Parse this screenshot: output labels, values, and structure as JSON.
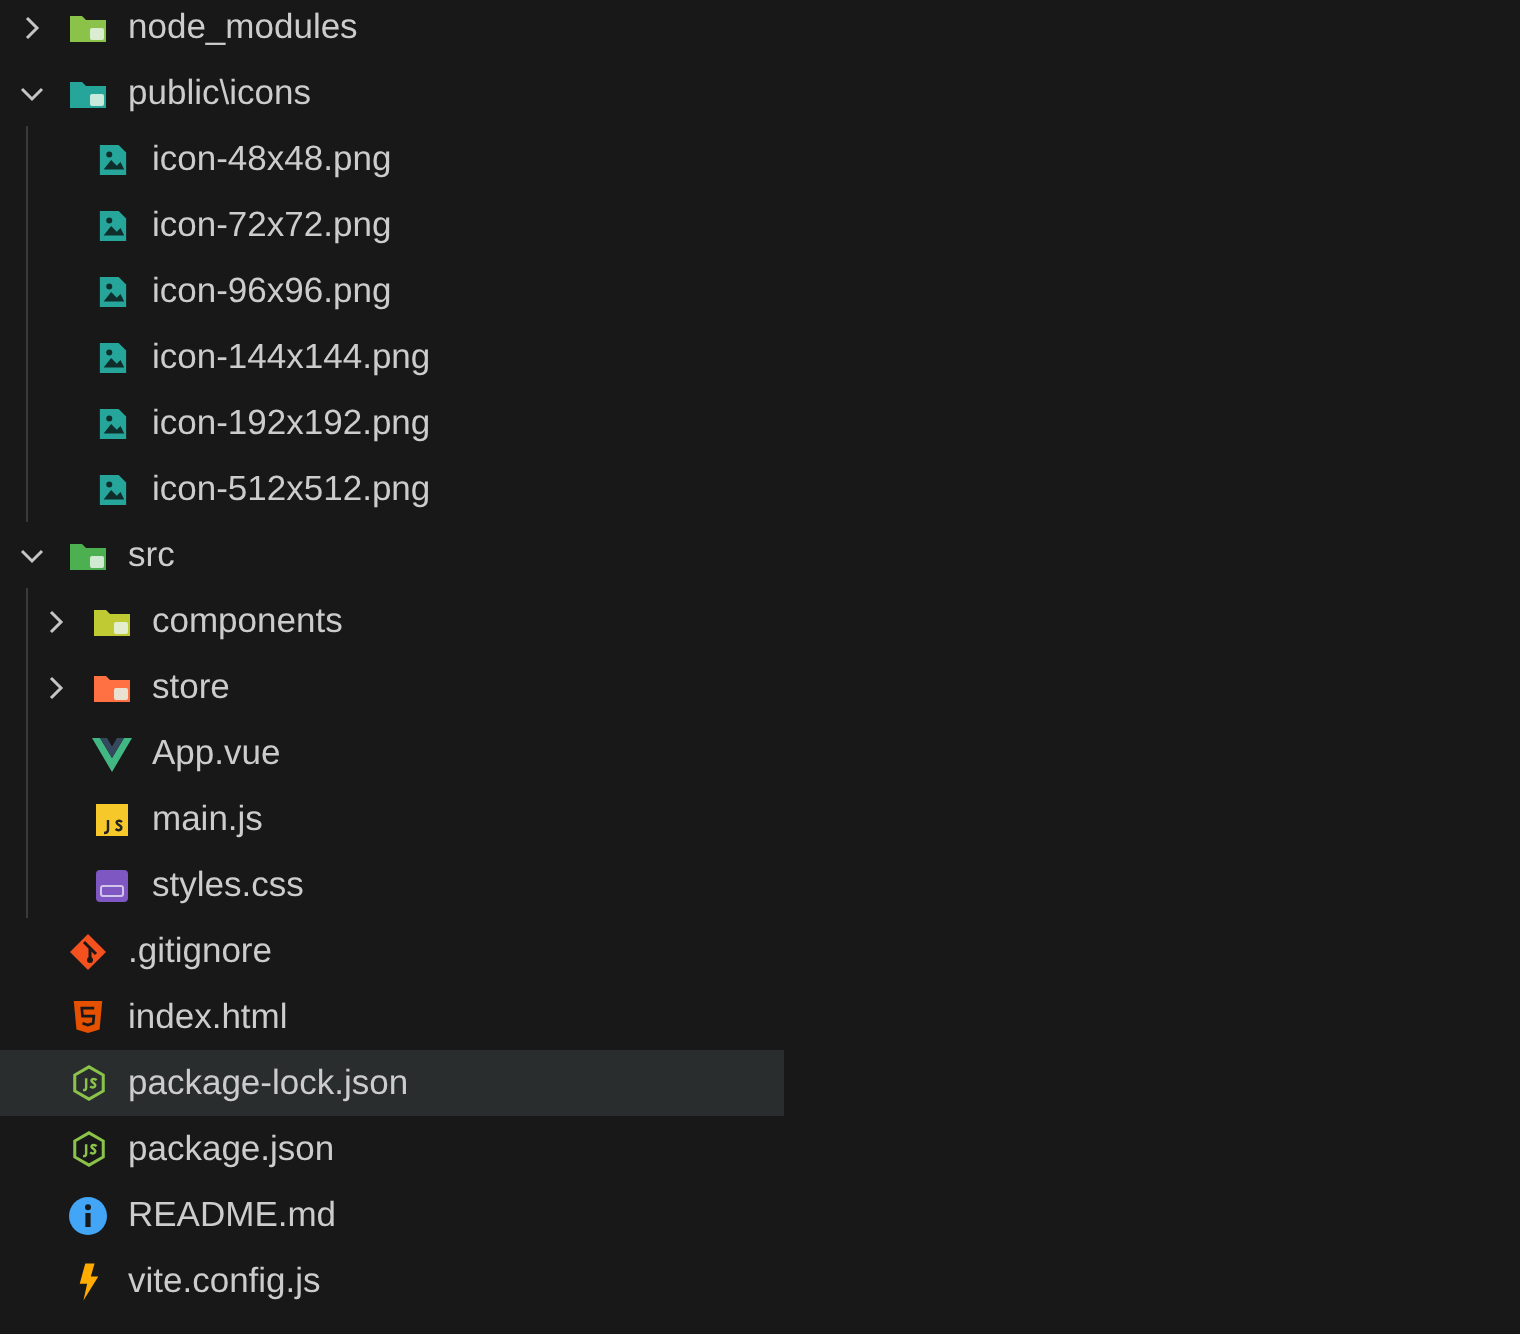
{
  "tree": [
    {
      "name": "node_modules",
      "kind": "folder-node",
      "expanded": false,
      "selected": false
    },
    {
      "name": "public\\icons",
      "kind": "folder-public",
      "expanded": true,
      "selected": false,
      "children": [
        {
          "name": "icon-48x48.png",
          "kind": "image",
          "selected": false
        },
        {
          "name": "icon-72x72.png",
          "kind": "image",
          "selected": false
        },
        {
          "name": "icon-96x96.png",
          "kind": "image",
          "selected": false
        },
        {
          "name": "icon-144x144.png",
          "kind": "image",
          "selected": false
        },
        {
          "name": "icon-192x192.png",
          "kind": "image",
          "selected": false
        },
        {
          "name": "icon-512x512.png",
          "kind": "image",
          "selected": false
        }
      ]
    },
    {
      "name": "src",
      "kind": "folder-src",
      "expanded": true,
      "selected": false,
      "children": [
        {
          "name": "components",
          "kind": "folder-components",
          "expanded": false,
          "selected": false
        },
        {
          "name": "store",
          "kind": "folder-store",
          "expanded": false,
          "selected": false
        },
        {
          "name": "App.vue",
          "kind": "vue",
          "selected": false
        },
        {
          "name": "main.js",
          "kind": "js",
          "selected": false
        },
        {
          "name": "styles.css",
          "kind": "css",
          "selected": false
        }
      ]
    },
    {
      "name": ".gitignore",
      "kind": "git",
      "selected": false
    },
    {
      "name": "index.html",
      "kind": "html",
      "selected": false
    },
    {
      "name": "package-lock.json",
      "kind": "node",
      "selected": true
    },
    {
      "name": "package.json",
      "kind": "node",
      "selected": false
    },
    {
      "name": "README.md",
      "kind": "info",
      "selected": false
    },
    {
      "name": "vite.config.js",
      "kind": "vite",
      "selected": false
    }
  ]
}
